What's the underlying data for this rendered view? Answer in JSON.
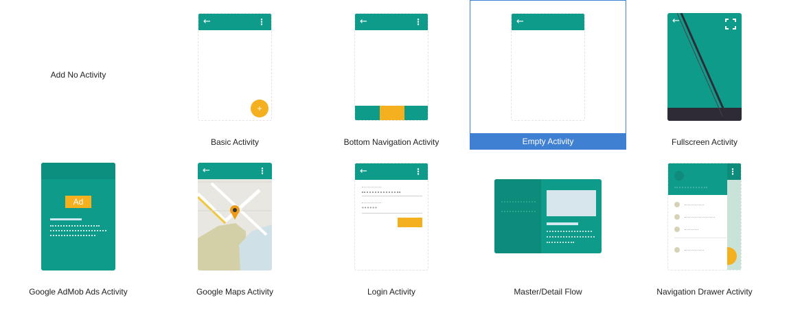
{
  "templates": [
    {
      "label": "Add No Activity"
    },
    {
      "label": "Basic Activity"
    },
    {
      "label": "Bottom Navigation Activity"
    },
    {
      "label": "Empty Activity"
    },
    {
      "label": "Fullscreen Activity"
    },
    {
      "label": "Google AdMob Ads Activity"
    },
    {
      "label": "Google Maps Activity"
    },
    {
      "label": "Login Activity"
    },
    {
      "label": "Master/Detail Flow"
    },
    {
      "label": "Navigation Drawer Activity"
    }
  ],
  "selected_template": "Empty Activity",
  "preview": {
    "back_glyph": "←",
    "menu_glyph": "⋮",
    "fab_glyph": "+",
    "ad_text": "Ad",
    "password_mask": "••••••"
  },
  "colors": {
    "teal": "#0f9b8a",
    "amber": "#f4b01f",
    "selection": "#3f80d2",
    "dark_strip": "#2f2b36"
  }
}
